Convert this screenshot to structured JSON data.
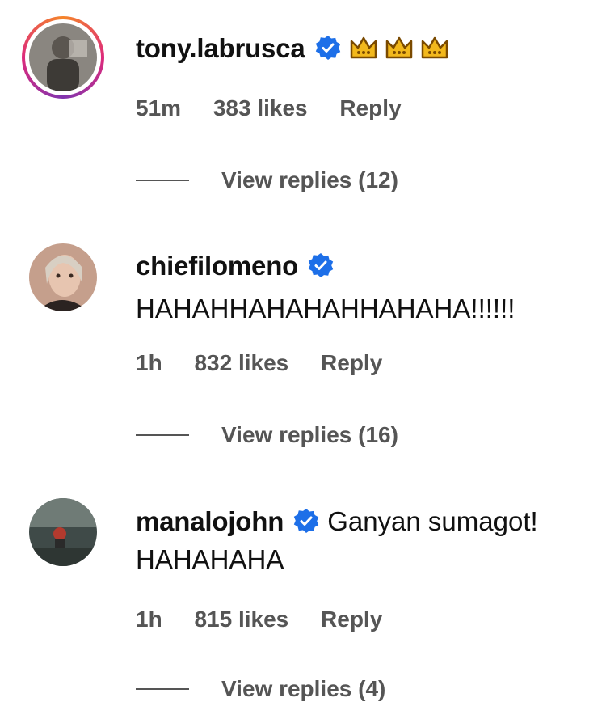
{
  "comments": [
    {
      "username": "tony.labrusca",
      "verified": true,
      "text": "",
      "emoji": [
        "crown",
        "crown",
        "crown"
      ],
      "time": "51m",
      "likes": "383 likes",
      "reply_label": "Reply",
      "view_replies": "View replies (12)"
    },
    {
      "username": "chiefilomeno",
      "verified": true,
      "text": "HAHAHHAHAHAHHAHAHA!!!!!!",
      "time": "1h",
      "likes": "832 likes",
      "reply_label": "Reply",
      "view_replies": "View replies (16)"
    },
    {
      "username": "manalojohn",
      "verified": true,
      "text": "Ganyan sumagot!",
      "text_line2": "HAHAHAHA",
      "time": "1h",
      "likes": "815 likes",
      "reply_label": "Reply",
      "view_replies": "View replies (4)"
    }
  ],
  "colors": {
    "verified_blue": "#1d6fe8",
    "crown_gold": "#f2b81c",
    "meta_gray": "#555555"
  }
}
